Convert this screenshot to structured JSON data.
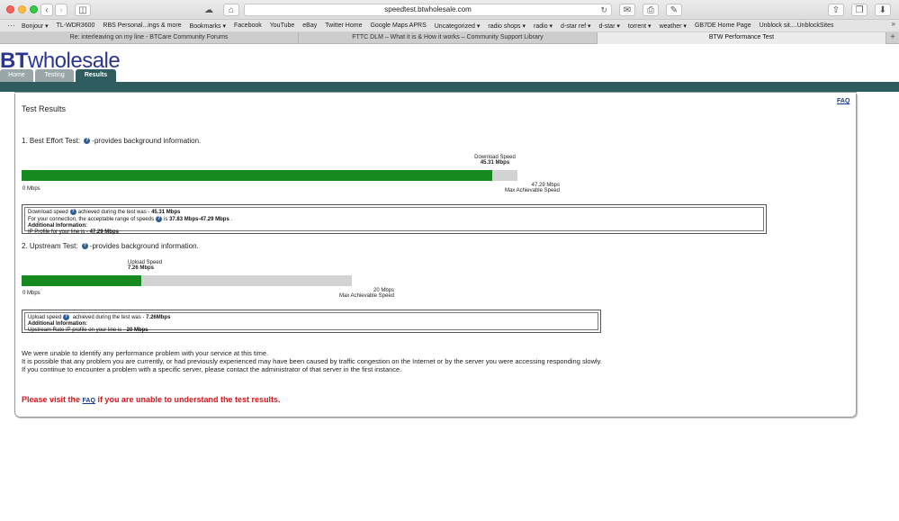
{
  "browser": {
    "url": "speedtest.btwholesale.com",
    "bookmarks": [
      "Bonjour ▾",
      "TL-WDR3600",
      "RBS Personal...ings & more",
      "Bookmarks ▾",
      "Facebook",
      "YouTube",
      "eBay",
      "Twitter Home",
      "Google Maps APRS",
      "Uncategorized ▾",
      "radio shops ▾",
      "radio ▾",
      "d-star ref ▾",
      "d-star ▾",
      "torrent ▾",
      "weather ▾",
      "GB7DE Home Page",
      "Unblock sit....UnblockSites"
    ],
    "tabs": [
      {
        "title": "Re: interleaving on my line - BTCare Community Forums"
      },
      {
        "title": "FTTC DLM – What it is & How it works – Community Support Library"
      },
      {
        "title": "BTW Performance Test"
      }
    ]
  },
  "site": {
    "logo_bt": "BT",
    "logo_rest": "wholesale",
    "nav": [
      "Home",
      "Testing",
      "Results"
    ]
  },
  "results": {
    "title": "Test Results",
    "faq": "FAQ",
    "best_effort": {
      "heading": "1. Best Effort Test:",
      "heading_suffix": "-provides background information.",
      "speed_label": "Download Speed",
      "speed_value": "45.31 Mbps",
      "min_label": "0 Mbps",
      "max_value": "47.29 Mbps",
      "max_label": "Max Achievable Speed",
      "fill_fraction": 0.949,
      "info_line1_a": "Download speed",
      "info_line1_b": "achieved during the test was - ",
      "info_line1_val": "45.31 Mbps",
      "info_line2_a": "For your connection, the acceptable range of speeds",
      "info_line2_b": "is ",
      "info_line2_val": "37.83 Mbps-47.29 Mbps",
      "info_line2_end": " .",
      "info_line3": "Additional Information:",
      "info_line4_a": "IP Profile for your line is - ",
      "info_line4_val": "47.29 Mbps"
    },
    "upstream": {
      "heading": "2. Upstream Test:",
      "heading_suffix": "-provides background information.",
      "speed_label": "Upload Speed",
      "speed_value": "7.26 Mbps",
      "min_label": "0 Mbps",
      "max_value": "20 Mbps",
      "max_label": "Max Achievable Speed",
      "fill_fraction": 0.363,
      "info_line1_a": "Upload speed",
      "info_line1_b": " achieved during the test was - ",
      "info_line1_val": "7.26Mbps",
      "info_line2": "Additional Information:",
      "info_line3_a": "Upstream Rate IP profile on your line is - ",
      "info_line3_val": "20 Mbps"
    },
    "message_lines": [
      "We were unable to identify any performance problem with your service at this time.",
      "It is possible that any problem you are currently, or had previously experienced may have been caused by traffic congestion on the Internet or by the server you were accessing responding slowly.",
      "If you continue to encounter a problem with a specific server, please contact the administrator of that server in the first instance."
    ],
    "visit_a": "Please visit the ",
    "visit_faq": "FAQ",
    "visit_b": " if you are unable to understand the test results."
  }
}
